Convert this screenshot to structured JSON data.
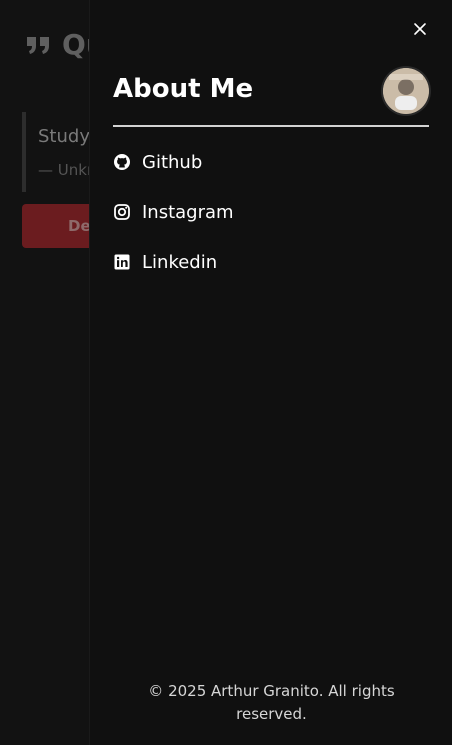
{
  "background": {
    "header_title": "Qu",
    "quote_text": "Study",
    "quote_author": "— Unkn",
    "button_label": "De"
  },
  "drawer": {
    "title": "About Me",
    "close_icon": "close-icon",
    "avatar_icon": "avatar",
    "links": [
      {
        "label": "Github",
        "icon": "github-icon"
      },
      {
        "label": "Instagram",
        "icon": "instagram-icon"
      },
      {
        "label": "Linkedin",
        "icon": "linkedin-icon"
      }
    ],
    "footer": "© 2025 Arthur Granito. All rights reserved."
  },
  "colors": {
    "background": "#121212",
    "drawer_bg": "#101010",
    "text": "#ffffff",
    "muted": "#5f5f5f",
    "accent_button": "#6b1c1f"
  }
}
